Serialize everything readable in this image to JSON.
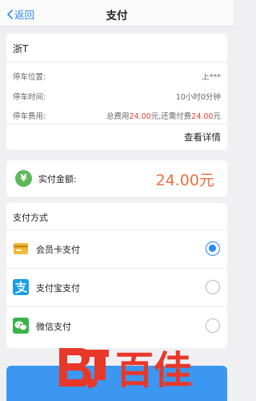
{
  "nav": {
    "back_label": "返回",
    "title": "支付"
  },
  "info": {
    "plate": "浙T",
    "location_label": "停车位置:",
    "location_value": "上***",
    "time_label": "停车时间:",
    "time_value": "10小时0分钟",
    "fee_label": "停车费用:",
    "fee_prefix": "总费用",
    "fee_total": "24.00",
    "fee_middle": "元,还需付费",
    "fee_due": "24.00",
    "fee_suffix": "元",
    "detail_link": "查看详情"
  },
  "amount": {
    "icon": "yen-icon",
    "symbol": "¥",
    "label": "实付金额:",
    "value": "24.00元"
  },
  "payment": {
    "header": "支付方式",
    "methods": [
      {
        "label": "会员卡支付",
        "icon": "member-card-icon",
        "selected": true
      },
      {
        "label": "支付宝支付",
        "icon": "alipay-icon",
        "selected": false
      },
      {
        "label": "微信支付",
        "icon": "wechat-icon",
        "selected": false
      }
    ]
  },
  "watermark": {
    "text": "百佳",
    "logo": "bj-logo"
  },
  "colors": {
    "accent": "#2a8af0",
    "amount": "#ef6f3a",
    "fee_red": "#e63d2e",
    "button": "#3b97ef"
  }
}
